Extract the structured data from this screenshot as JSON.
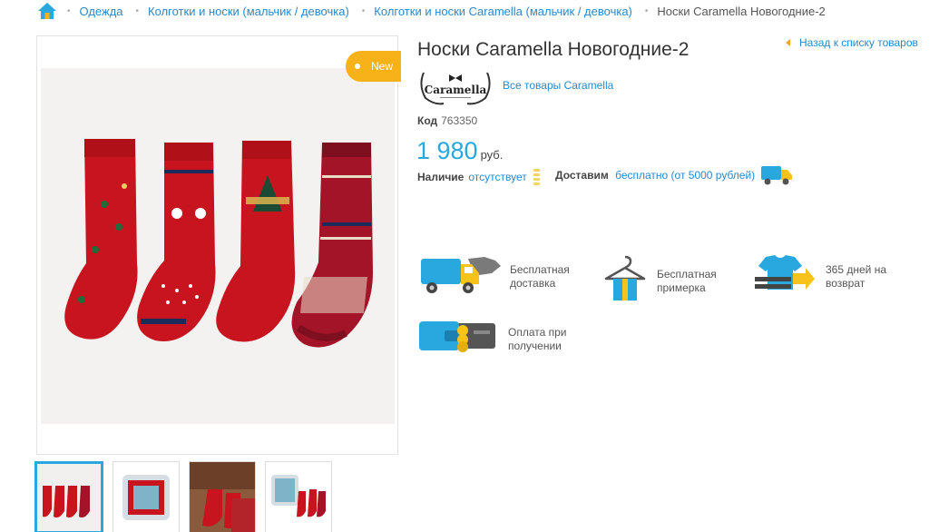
{
  "breadcrumb": {
    "items": [
      "Одежда",
      "Колготки и носки (мальчик / девочка)",
      "Колготки и носки Caramella (мальчик / девочка)"
    ],
    "current": "Носки Caramella Новогодние-2"
  },
  "gallery": {
    "badge": "New",
    "thumbnails": [
      "photo-1",
      "photo-2",
      "photo-3",
      "photo-4"
    ],
    "active_index": 0
  },
  "product": {
    "title": "Носки Caramella Новогодние-2",
    "back_label": "Назад к списку товаров",
    "brand_logo_text": "Caramella",
    "brand_link": "Все товары Caramella",
    "code_label": "Код",
    "code_value": "763350",
    "price": "1 980",
    "currency": "руб.",
    "availability_label": "Наличие",
    "availability_value": "отсутствует",
    "delivery_label": "Доставим",
    "delivery_value": "бесплатно (от 5000 рублей)"
  },
  "features": [
    {
      "icon": "delivery-truck-icon",
      "line1": "Бесплатная",
      "line2": "доставка"
    },
    {
      "icon": "hanger-icon",
      "line1": "Бесплатная",
      "line2": "примерка"
    },
    {
      "icon": "return-shirt-icon",
      "line1": "365 дней на",
      "line2": "возврат"
    },
    {
      "icon": "wallet-icon",
      "line1": "Оплата при",
      "line2": "получении"
    }
  ],
  "colors": {
    "link": "#2a88c8",
    "price": "#29a7df",
    "badge": "#f7b21a",
    "sock_red": "#c8141e"
  }
}
